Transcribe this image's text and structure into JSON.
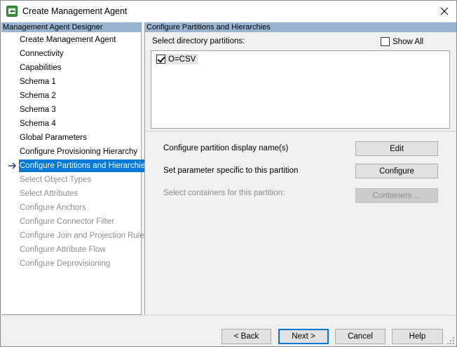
{
  "window": {
    "title": "Create Management Agent",
    "icon": "management-agent-icon",
    "close_icon": "close-icon"
  },
  "nav": {
    "header": "Management Agent Designer",
    "items": [
      {
        "label": "Create Management Agent",
        "state": "enabled"
      },
      {
        "label": "Connectivity",
        "state": "enabled"
      },
      {
        "label": "Capabilities",
        "state": "enabled"
      },
      {
        "label": "Schema 1",
        "state": "enabled"
      },
      {
        "label": "Schema 2",
        "state": "enabled"
      },
      {
        "label": "Schema 3",
        "state": "enabled"
      },
      {
        "label": "Schema 4",
        "state": "enabled"
      },
      {
        "label": "Global Parameters",
        "state": "enabled"
      },
      {
        "label": "Configure Provisioning Hierarchy",
        "state": "enabled"
      },
      {
        "label": "Configure Partitions and Hierarchies",
        "state": "active"
      },
      {
        "label": "Select Object Types",
        "state": "disabled"
      },
      {
        "label": "Select Attributes",
        "state": "disabled"
      },
      {
        "label": "Configure Anchors",
        "state": "disabled"
      },
      {
        "label": "Configure Connector Filter",
        "state": "disabled"
      },
      {
        "label": "Configure Join and Projection Rules",
        "state": "disabled"
      },
      {
        "label": "Configure Attribute Flow",
        "state": "disabled"
      },
      {
        "label": "Configure Deprovisioning",
        "state": "disabled"
      }
    ]
  },
  "main": {
    "header": "Configure Partitions and Hierarchies",
    "partitions_label": "Select directory partitions:",
    "show_all_label": "Show All",
    "show_all_checked": false,
    "partitions": [
      {
        "name": "O=CSV",
        "checked": true
      }
    ],
    "options": [
      {
        "label": "Configure partition display name(s)",
        "button": "Edit",
        "enabled": true
      },
      {
        "label": "Set parameter specific to this partition",
        "button": "Configure",
        "enabled": true
      },
      {
        "label": "Select containers for this partition:",
        "button": "Containers ...",
        "enabled": false
      }
    ]
  },
  "footer": {
    "back": "< Back",
    "next": "Next >",
    "cancel": "Cancel",
    "help": "Help"
  },
  "colors": {
    "header_bg": "#99b4d1",
    "selection": "#0078d7",
    "disabled_text": "#8d8d8d"
  }
}
